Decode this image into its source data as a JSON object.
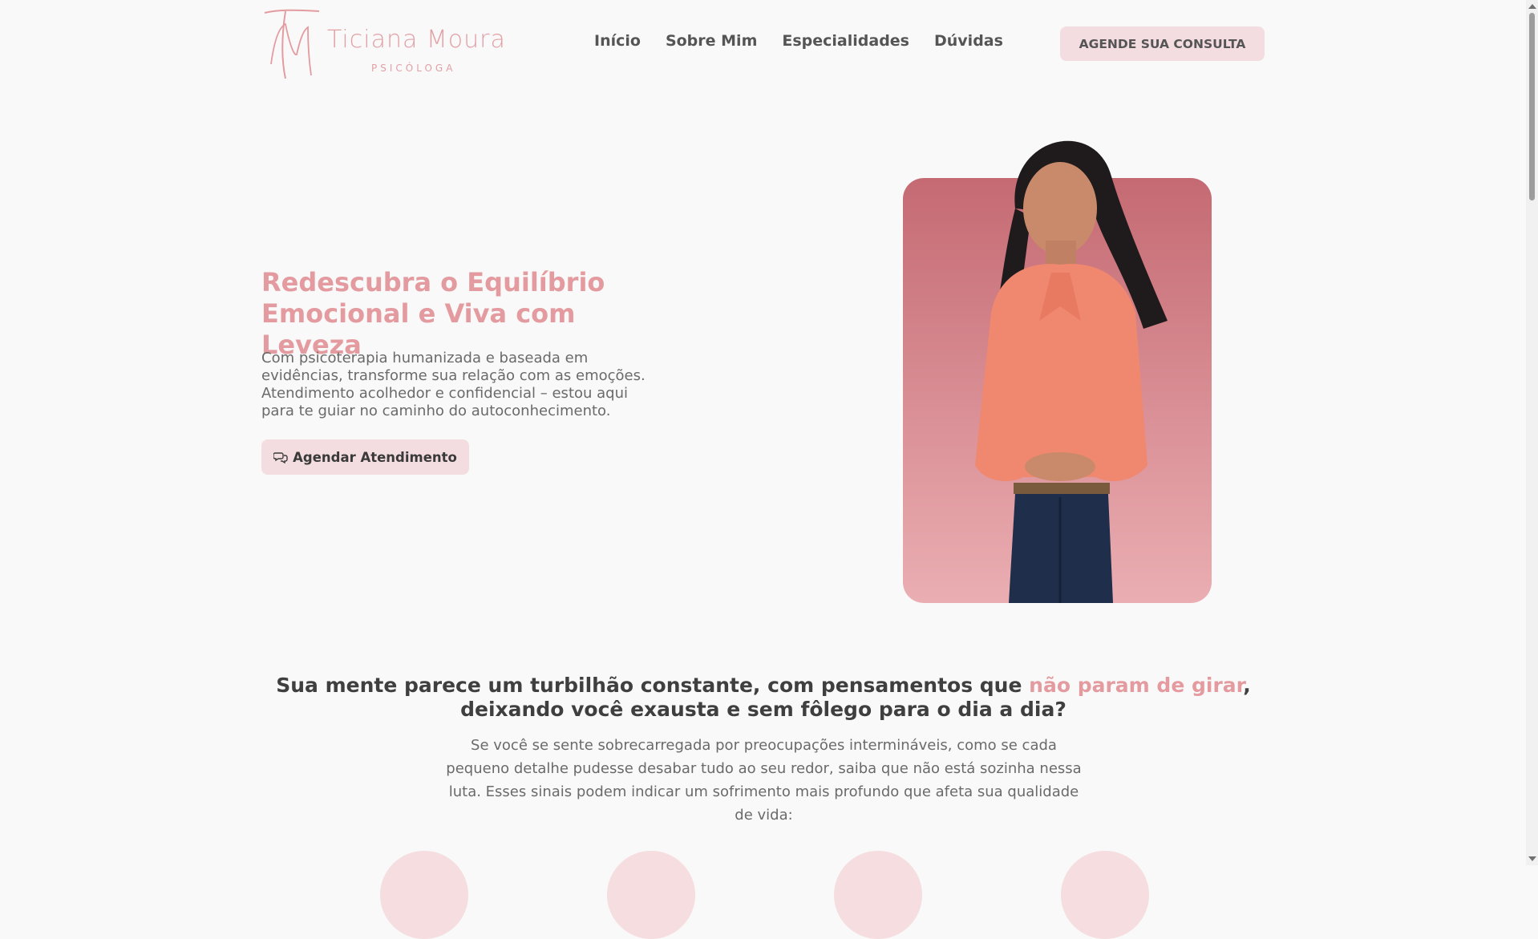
{
  "colors": {
    "brand_pink": "#e49ba0",
    "button_bg": "#f4dde0",
    "photo_bg_top": "#c56a73",
    "photo_bg_bottom": "#eaaeb2",
    "page_bg": "#f9f9f9"
  },
  "logo": {
    "monogram": "TM",
    "name": "Ticiana Moura",
    "subtitle": "PSICÓLOGA"
  },
  "nav": {
    "items": [
      {
        "label": "Início"
      },
      {
        "label": "Sobre Mim"
      },
      {
        "label": "Especialidades"
      },
      {
        "label": "Dúvidas"
      }
    ]
  },
  "header": {
    "cta_label": "AGENDE SUA CONSULTA"
  },
  "hero": {
    "title": "Redescubra o Equilíbrio Emocional e Viva com Leveza",
    "description": "Com psicoterapia humanizada e baseada em evidências, transforme sua relação com as emoções. Atendimento acolhedor e confidencial – estou aqui para te guiar no caminho do autoconhecimento.",
    "cta_label": "Agendar Atendimento",
    "cta_icon": "chat-bubbles-icon",
    "photo": "portrait-of-psychologist"
  },
  "pain": {
    "title_part1": "Sua mente parece um turbilhão constante, com pensamentos que ",
    "title_highlight": "não param de girar",
    "title_part2": ", deixando você exausta e sem fôlego para o dia a dia?",
    "description": "Se você se sente sobrecarregada por preocupações intermináveis, como se cada pequeno detalhe pudesse desabar tudo ao seu redor, saiba que não está sozinha nessa luta. Esses sinais podem indicar um sofrimento mais profundo que afeta sua qualidade de vida:",
    "item_icons": [
      "symptom-icon-1",
      "symptom-icon-2",
      "symptom-icon-3",
      "symptom-icon-4"
    ]
  }
}
